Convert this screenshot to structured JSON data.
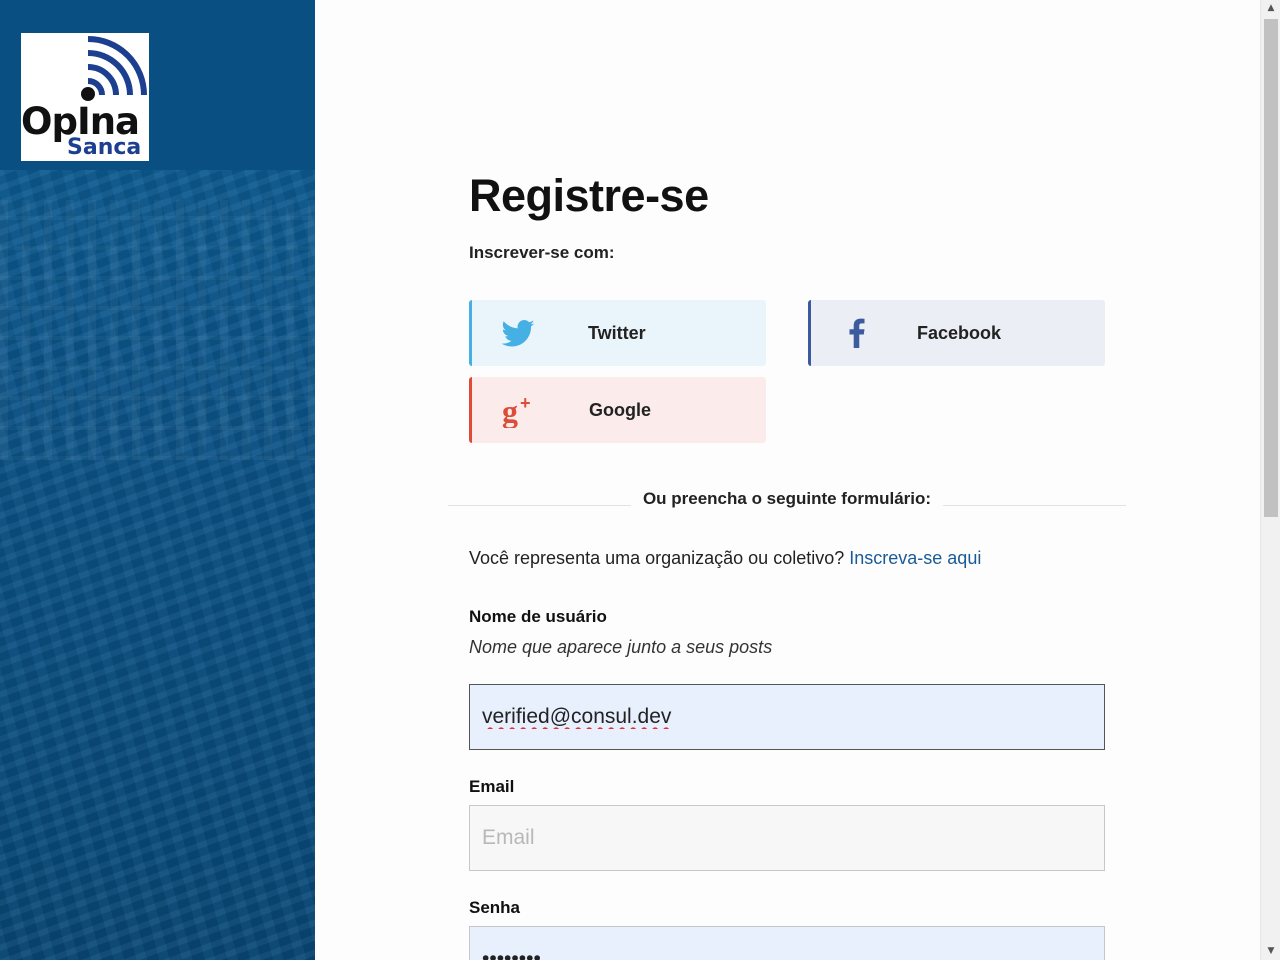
{
  "brand": {
    "logo_word": "OpIna",
    "logo_sub": "Sanca"
  },
  "header": {
    "title": "Registre-se",
    "subtitle": "Inscrever-se com:"
  },
  "social": {
    "twitter_label": "Twitter",
    "facebook_label": "Facebook",
    "google_label": "Google"
  },
  "divider_text": "Ou preencha o seguinte formulário:",
  "organization": {
    "question": "Você representa uma organização ou coletivo?",
    "link_text": "Inscreva-se aqui"
  },
  "form": {
    "username": {
      "label": "Nome de usuário",
      "help": "Nome que aparece junto a seus posts",
      "value": "verified@consul.dev"
    },
    "email": {
      "label": "Email",
      "placeholder": "Email",
      "value": ""
    },
    "password": {
      "label": "Senha",
      "value": "••••••••"
    }
  },
  "colors": {
    "sidebar_bg": "#0a4f82",
    "twitter": "#45b0e3",
    "facebook": "#3b5b9e",
    "google": "#dd4b39",
    "link": "#1a5a96"
  },
  "icons": {
    "twitter": "twitter-bird-icon",
    "facebook": "facebook-f-icon",
    "google": "google-plus-icon",
    "logo": "signal-waves-icon"
  }
}
